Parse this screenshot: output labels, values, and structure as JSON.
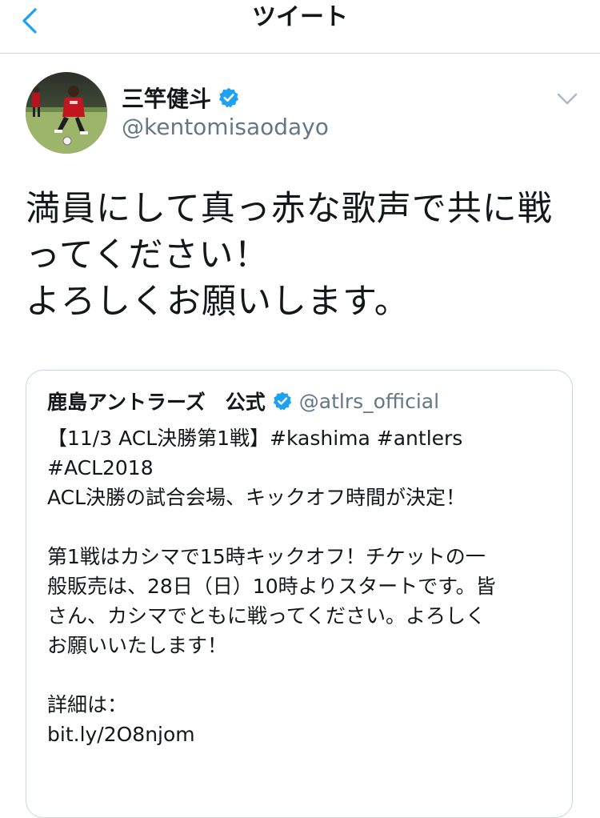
{
  "navbar": {
    "title": "ツイート",
    "back_icon": "chevron-left-icon",
    "accent": "#1da1f2"
  },
  "tweet": {
    "author_name": "三竿健斗",
    "author_handle": "@kentomisaodayo",
    "verified_icon": "verified-badge-icon",
    "menu_icon": "chevron-down-icon",
    "text_lines": [
      "満員にして真っ赤な歌声で共に戦",
      "ってください！",
      "よろしくお願いします。"
    ]
  },
  "quote": {
    "author_name": "鹿島アントラーズ　公式",
    "author_handle": "@atlrs_official",
    "lines": [
      "【11/3 ACL決勝第1戦】#kashima #antlers",
      "#ACL2018",
      "ACL決勝の試合会場、キックオフ時間が決定！",
      "",
      "第1戦はカシマで15時キックオフ！チケットの一",
      "般販売は、28日（日）10時よりスタートです。皆",
      "さん、カシマでともに戦ってください。よろしく",
      "お願いいたします！",
      "",
      "詳細は：",
      "bit.ly/2O8njom"
    ]
  },
  "colors": {
    "text": "#14171a",
    "secondary": "#657786",
    "border": "#ccd6dd",
    "verified": "#1da1f2"
  }
}
